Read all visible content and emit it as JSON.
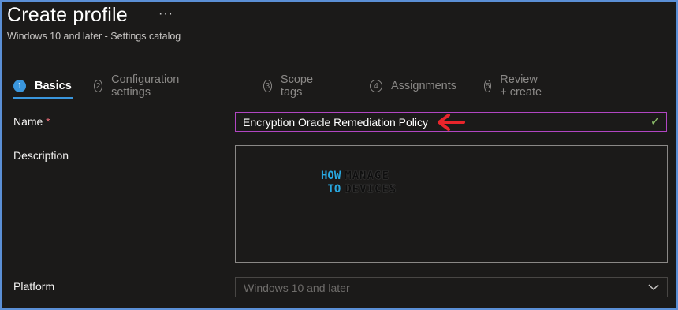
{
  "header": {
    "title": "Create profile",
    "more_label": "···",
    "subtitle": "Windows 10 and later - Settings catalog"
  },
  "steps": [
    {
      "num": "1",
      "label": "Basics",
      "active": true
    },
    {
      "num": "2",
      "label": "Configuration settings",
      "active": false
    },
    {
      "num": "3",
      "label": "Scope tags",
      "active": false
    },
    {
      "num": "4",
      "label": "Assignments",
      "active": false
    },
    {
      "num": "5",
      "label": "Review + create",
      "active": false
    }
  ],
  "form": {
    "name_label": "Name",
    "required_mark": "*",
    "name_value": "Encryption Oracle Remediation Policy",
    "description_label": "Description",
    "platform_label": "Platform",
    "platform_value": "Windows 10 and later"
  },
  "watermark": {
    "left_top": "HOW",
    "left_bottom": "TO",
    "right_top": "MANAGE",
    "right_bottom": "DEVICES"
  },
  "colors": {
    "accent": "#3a96dd",
    "focus_border": "#b146c2",
    "annotation_arrow": "#e8252b",
    "valid_check": "#8cbd6a",
    "frame_border": "#5b8fd6"
  },
  "icons": {
    "more": "ellipsis-icon",
    "valid": "checkmark-icon",
    "dropdown": "chevron-down-icon",
    "annotation": "red-arrow-icon"
  }
}
